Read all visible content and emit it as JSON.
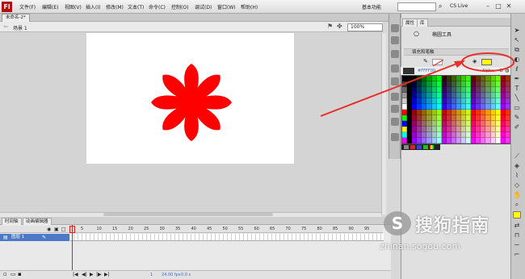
{
  "app": {
    "logo_text": "Fl"
  },
  "menu": {
    "items": [
      "文件(F)",
      "编辑(E)",
      "视图(V)",
      "插入(I)",
      "修改(M)",
      "文本(T)",
      "命令(C)",
      "控制(O)",
      "调试(D)",
      "窗口(W)",
      "帮助(H)"
    ],
    "workspace": "基本功能",
    "cs_live": "CS Live"
  },
  "document": {
    "tab_title": "未命名-2*",
    "scene_label": "场景 1",
    "zoom": "100%"
  },
  "stage": {
    "background": "#ffffff",
    "flower_color": "#ff0000"
  },
  "timeline": {
    "tabs": [
      "时间轴",
      "动画编辑器"
    ],
    "layer_name": "图层 1",
    "frame_numbers": [
      "5",
      "10",
      "15",
      "20",
      "25",
      "30",
      "35",
      "40",
      "45",
      "50",
      "55",
      "60",
      "65",
      "70",
      "75",
      "80",
      "85",
      "90",
      "95"
    ],
    "fps": "24.00 fps",
    "time": "0.0 s",
    "current_frame": "1"
  },
  "properties_panel": {
    "tabs": [
      "属性",
      "库"
    ],
    "tool_name": "椭圆工具",
    "section_title": "填充和笔触",
    "hex_value": "#FFFF00",
    "alpha_label": "Alpha:",
    "selected_fill_color": "#ffff00"
  },
  "annotation": {
    "color": "#e8302a"
  },
  "watermark": {
    "title": "搜狗指南",
    "url": "zhinan.sogou.com"
  },
  "icons": [
    "search-icon",
    "minimize-icon",
    "maximize-icon",
    "close-icon",
    "arrow-tool-icon",
    "pencil-icon",
    "paint-bucket-icon",
    "eyedropper-icon",
    "eraser-icon",
    "hand-icon",
    "zoom-icon",
    "play-icon"
  ]
}
